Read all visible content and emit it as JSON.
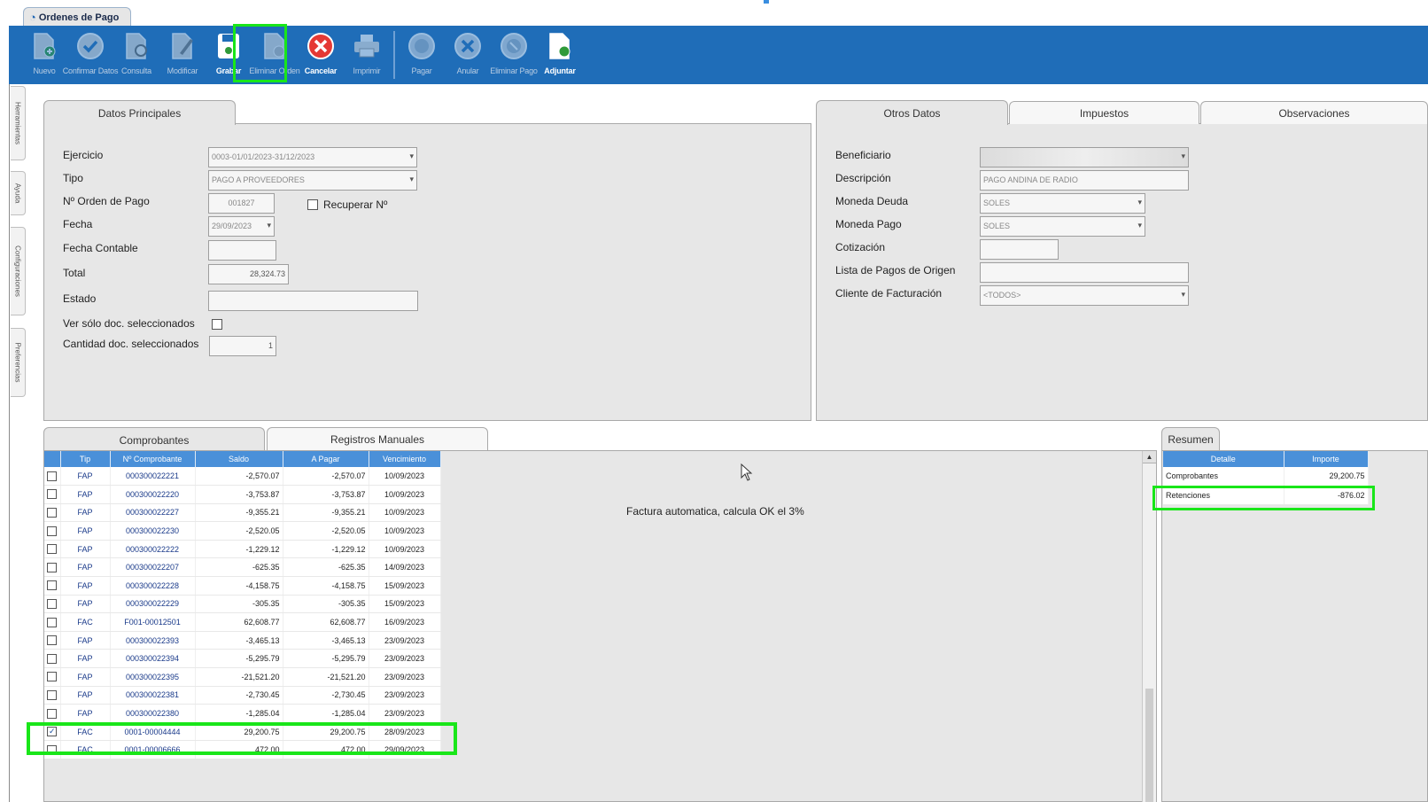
{
  "window": {
    "tab_title": "Ordenes de Pago"
  },
  "toolbar": {
    "buttons": [
      {
        "label": "Nuevo",
        "icon": "new-document-icon"
      },
      {
        "label": "Confirmar Datos",
        "icon": "check-circle-icon"
      },
      {
        "label": "Consulta",
        "icon": "document-search-icon"
      },
      {
        "label": "Modificar",
        "icon": "edit-document-icon"
      },
      {
        "label": "Grabar",
        "icon": "save-disk-icon"
      },
      {
        "label": "Eliminar Orden",
        "icon": "delete-document-icon"
      },
      {
        "label": "Cancelar",
        "icon": "cancel-circle-icon"
      },
      {
        "label": "Imprimir",
        "icon": "printer-icon"
      },
      {
        "label": "Pagar",
        "icon": "coin-icon"
      },
      {
        "label": "Anular",
        "icon": "x-circle-icon"
      },
      {
        "label": "Eliminar Pago",
        "icon": "coin-delete-icon"
      },
      {
        "label": "Adjuntar",
        "icon": "attach-document-icon"
      }
    ]
  },
  "side_tabs": [
    "Herramientas",
    "Ayuda",
    "Configuraciones",
    "Preferencias"
  ],
  "main_panel": {
    "tab": "Datos Principales",
    "ejercicio_label": "Ejercicio",
    "ejercicio_value": "0003-01/01/2023-31/12/2023",
    "tipo_label": "Tipo",
    "tipo_value": "PAGO A PROVEEDORES",
    "orden_label": "Nº Orden de Pago",
    "orden_value": "001827",
    "recuperar_label": "Recuperar Nº",
    "fecha_label": "Fecha",
    "fecha_value": "29/09/2023",
    "fecha_contable_label": "Fecha Contable",
    "fecha_contable_value": "",
    "total_label": "Total",
    "total_value": "28,324.73",
    "estado_label": "Estado",
    "estado_value": "",
    "ver_solo_label": "Ver sólo doc. seleccionados",
    "cantidad_label": "Cantidad doc. seleccionados",
    "cantidad_value": "1"
  },
  "other_panel": {
    "tabs": [
      "Otros Datos",
      "Impuestos",
      "Observaciones"
    ],
    "beneficiario_label": "Beneficiario",
    "beneficiario_value": "",
    "descripcion_label": "Descripción",
    "descripcion_value": "PAGO ANDINA DE RADIO",
    "moneda_deuda_label": "Moneda Deuda",
    "moneda_deuda_value": "SOLES",
    "moneda_pago_label": "Moneda Pago",
    "moneda_pago_value": "SOLES",
    "cotizacion_label": "Cotización",
    "cotizacion_value": "",
    "lista_pagos_label": "Lista de Pagos de Origen",
    "lista_pagos_value": "",
    "cliente_label": "Cliente de Facturación",
    "cliente_value": "<TODOS>"
  },
  "lower_tabs": [
    "Comprobantes",
    "Registros Manuales"
  ],
  "grid": {
    "headers": [
      "",
      "Tip",
      "Nº Comprobante",
      "Saldo",
      "A Pagar",
      "Vencimiento"
    ],
    "rows": [
      {
        "checked": false,
        "tip": "FAP",
        "num": "000300022221",
        "saldo": "-2,570.07",
        "apagar": "-2,570.07",
        "venc": "10/09/2023"
      },
      {
        "checked": false,
        "tip": "FAP",
        "num": "000300022220",
        "saldo": "-3,753.87",
        "apagar": "-3,753.87",
        "venc": "10/09/2023"
      },
      {
        "checked": false,
        "tip": "FAP",
        "num": "000300022227",
        "saldo": "-9,355.21",
        "apagar": "-9,355.21",
        "venc": "10/09/2023"
      },
      {
        "checked": false,
        "tip": "FAP",
        "num": "000300022230",
        "saldo": "-2,520.05",
        "apagar": "-2,520.05",
        "venc": "10/09/2023"
      },
      {
        "checked": false,
        "tip": "FAP",
        "num": "000300022222",
        "saldo": "-1,229.12",
        "apagar": "-1,229.12",
        "venc": "10/09/2023"
      },
      {
        "checked": false,
        "tip": "FAP",
        "num": "000300022207",
        "saldo": "-625.35",
        "apagar": "-625.35",
        "venc": "14/09/2023"
      },
      {
        "checked": false,
        "tip": "FAP",
        "num": "000300022228",
        "saldo": "-4,158.75",
        "apagar": "-4,158.75",
        "venc": "15/09/2023"
      },
      {
        "checked": false,
        "tip": "FAP",
        "num": "000300022229",
        "saldo": "-305.35",
        "apagar": "-305.35",
        "venc": "15/09/2023"
      },
      {
        "checked": false,
        "tip": "FAC",
        "num": "F001-00012501",
        "saldo": "62,608.77",
        "apagar": "62,608.77",
        "venc": "16/09/2023"
      },
      {
        "checked": false,
        "tip": "FAP",
        "num": "000300022393",
        "saldo": "-3,465.13",
        "apagar": "-3,465.13",
        "venc": "23/09/2023"
      },
      {
        "checked": false,
        "tip": "FAP",
        "num": "000300022394",
        "saldo": "-5,295.79",
        "apagar": "-5,295.79",
        "venc": "23/09/2023"
      },
      {
        "checked": false,
        "tip": "FAP",
        "num": "000300022395",
        "saldo": "-21,521.20",
        "apagar": "-21,521.20",
        "venc": "23/09/2023"
      },
      {
        "checked": false,
        "tip": "FAP",
        "num": "000300022381",
        "saldo": "-2,730.45",
        "apagar": "-2,730.45",
        "venc": "23/09/2023"
      },
      {
        "checked": false,
        "tip": "FAP",
        "num": "000300022380",
        "saldo": "-1,285.04",
        "apagar": "-1,285.04",
        "venc": "23/09/2023"
      },
      {
        "checked": true,
        "tip": "FAC",
        "num": "0001-00004444",
        "saldo": "29,200.75",
        "apagar": "29,200.75",
        "venc": "28/09/2023"
      },
      {
        "checked": false,
        "tip": "FAC",
        "num": "0001-00006666",
        "saldo": "472.00",
        "apagar": "472.00",
        "venc": "29/09/2023"
      }
    ]
  },
  "annotation": "Factura automatica, calcula OK el 3%",
  "summary": {
    "tab": "Resumen",
    "headers": [
      "Detalle",
      "Importe"
    ],
    "rows": [
      {
        "detalle": "Comprobantes",
        "importe": "29,200.75"
      },
      {
        "detalle": "Retenciones",
        "importe": "-876.02"
      }
    ]
  },
  "colors": {
    "toolbar": "#1f6db8",
    "grid_header": "#4a90d9",
    "highlight": "#19e619",
    "panel": "#e7e7e7"
  }
}
